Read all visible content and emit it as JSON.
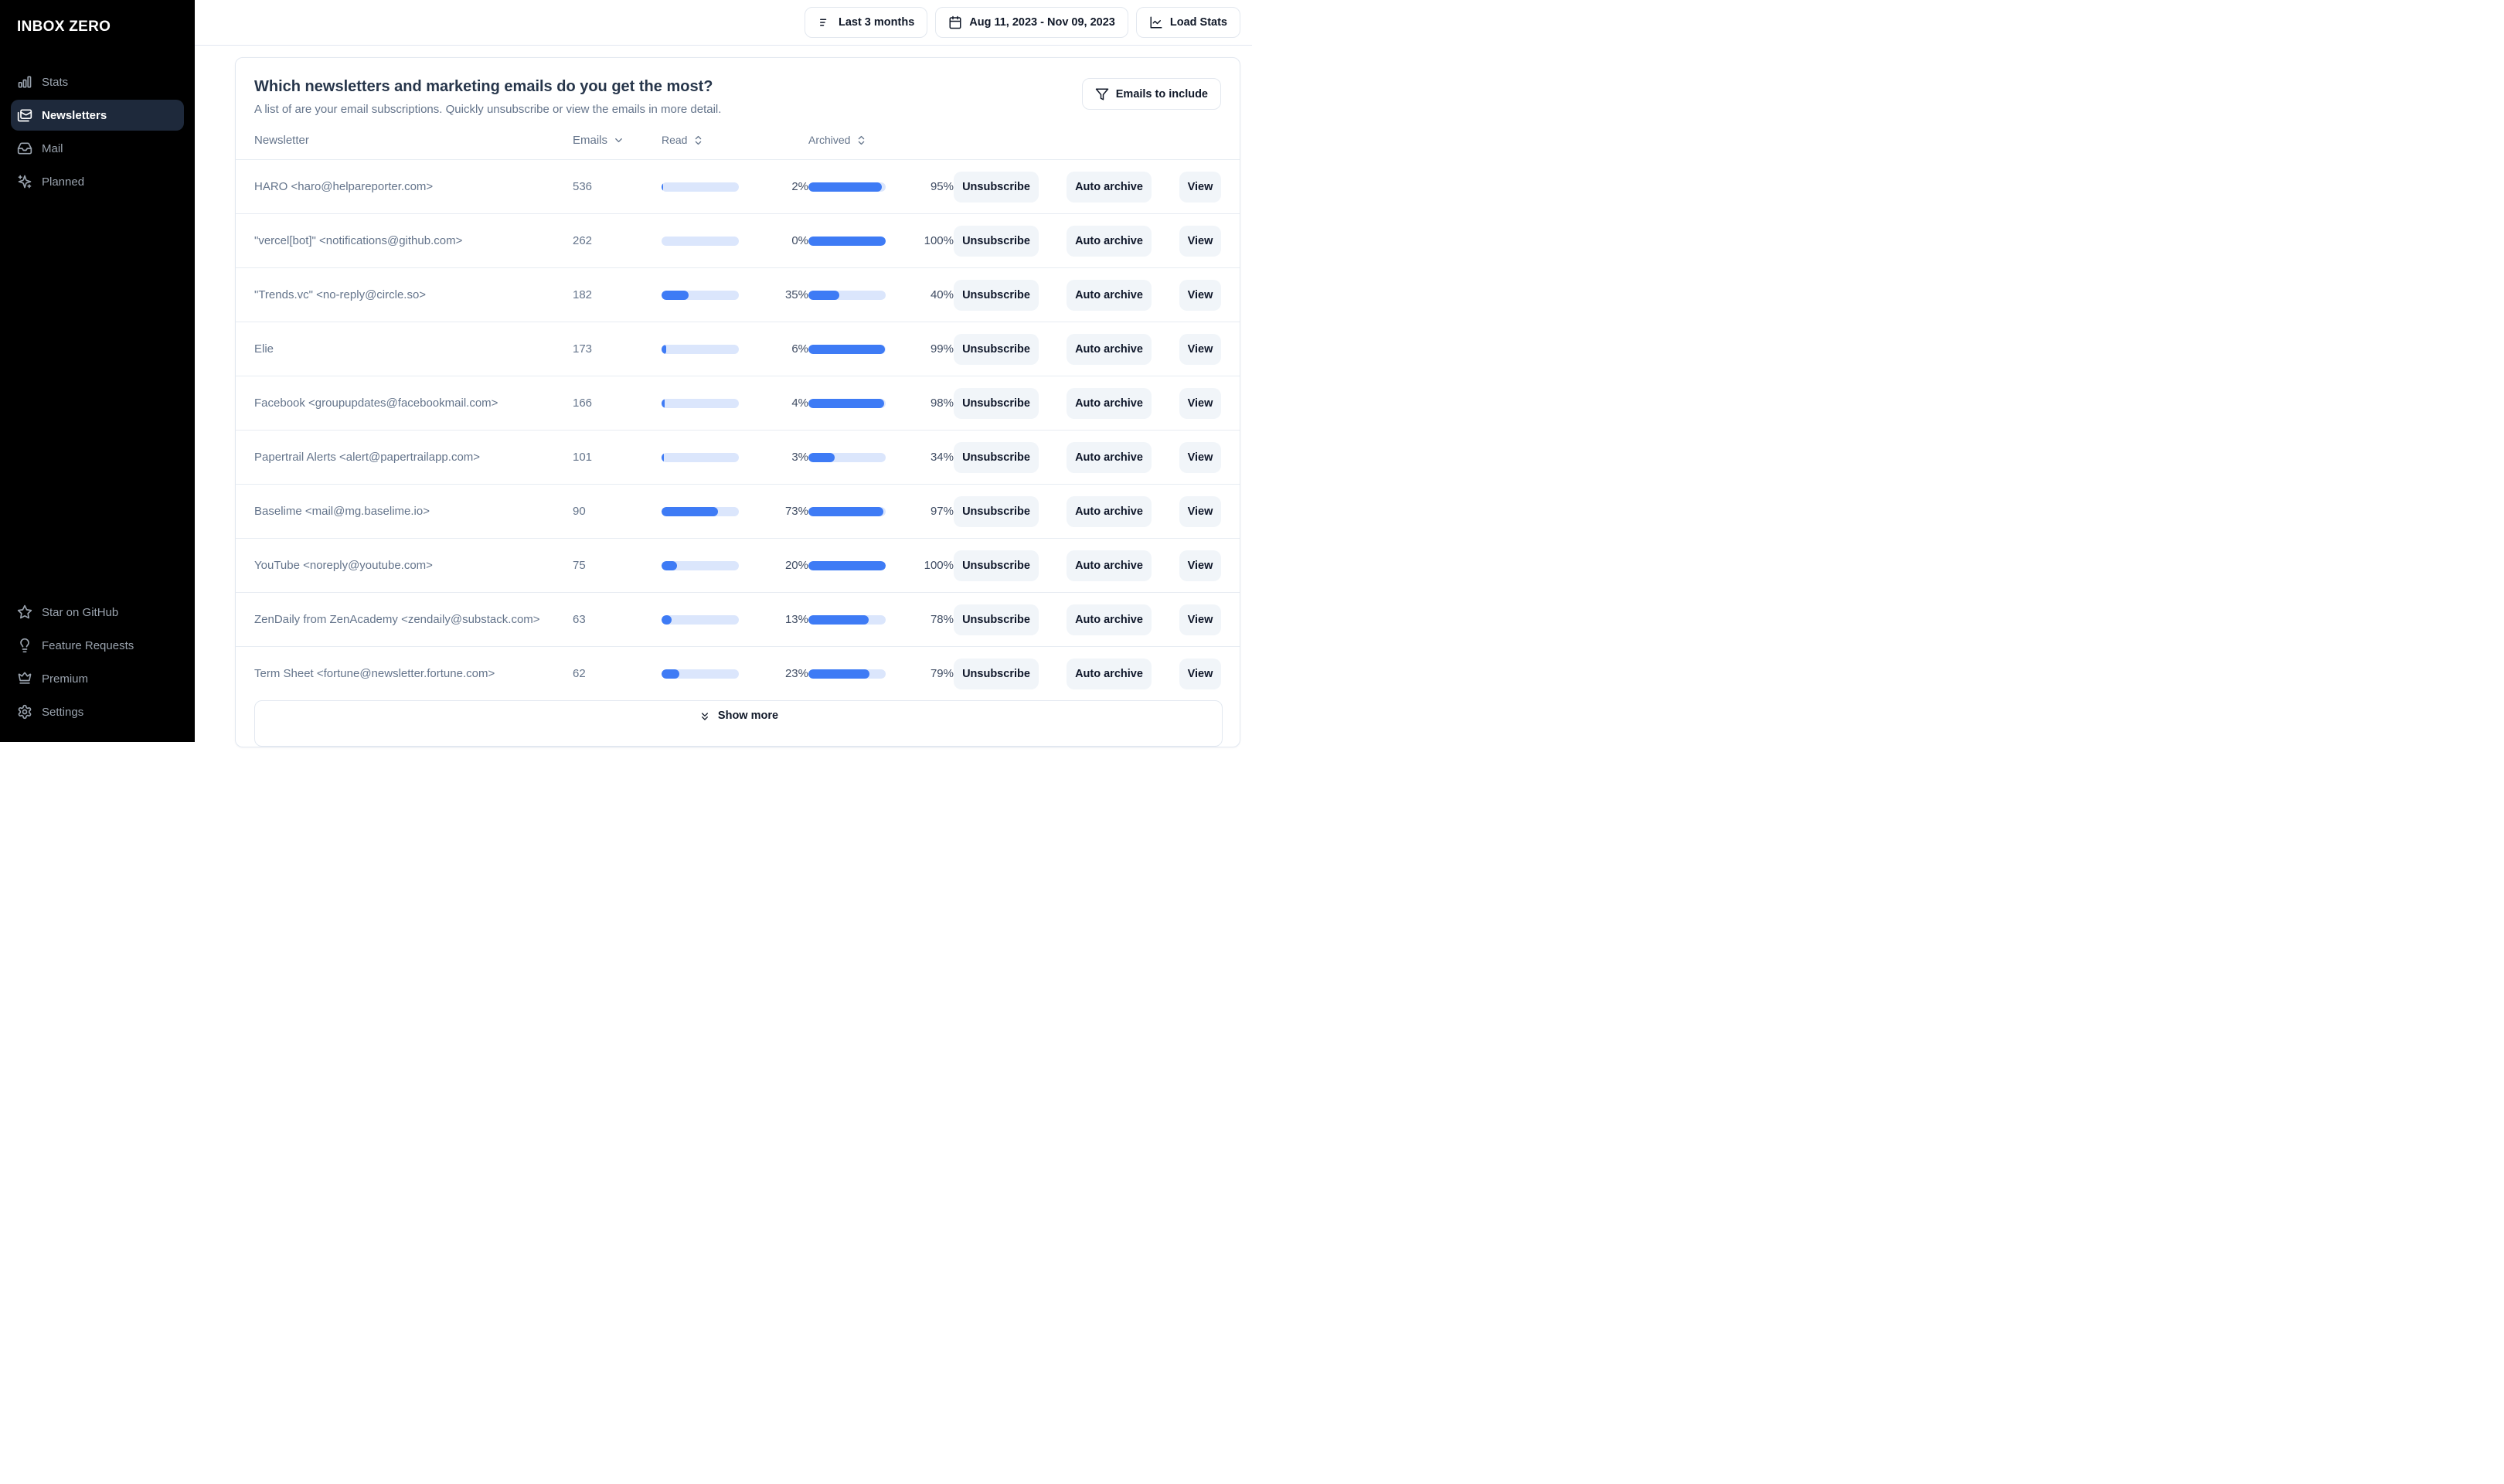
{
  "app": {
    "logo": "INBOX ZERO"
  },
  "colors": {
    "sidebar_bg": "#000000",
    "active_item_bg": "#1e293b",
    "accent_blue": "#3e7bf5",
    "bar_track": "#dbe6fc",
    "button_gray": "#f1f5f9",
    "border": "#e2e8f0"
  },
  "sidebar": {
    "items": [
      {
        "label": "Stats",
        "icon": "bar-chart-icon",
        "active": false
      },
      {
        "label": "Newsletters",
        "icon": "mails-icon",
        "active": true
      },
      {
        "label": "Mail",
        "icon": "inbox-icon",
        "active": false
      },
      {
        "label": "Planned",
        "icon": "sparkles-icon",
        "active": false
      }
    ],
    "footer_items": [
      {
        "label": "Star on GitHub",
        "icon": "star-icon",
        "active": false
      },
      {
        "label": "Feature Requests",
        "icon": "lightbulb-icon",
        "active": false
      },
      {
        "label": "Premium",
        "icon": "crown-icon",
        "active": false
      },
      {
        "label": "Settings",
        "icon": "gear-icon",
        "active": false
      }
    ]
  },
  "topbar": {
    "buttons": [
      {
        "label": "Last 3 months",
        "icon": "filter-lines-icon"
      },
      {
        "label": "Aug 11, 2023 - Nov 09, 2023",
        "icon": "calendar-icon"
      },
      {
        "label": "Load Stats",
        "icon": "line-chart-icon"
      }
    ]
  },
  "panel": {
    "title": "Which newsletters and marketing emails do you get the most?",
    "subtitle": "A list of are your email subscriptions. Quickly unsubscribe or view the emails in more detail.",
    "filter_button": {
      "label": "Emails to include",
      "icon": "funnel-icon"
    },
    "columns": {
      "newsletter": "Newsletter",
      "emails": "Emails",
      "read": "Read",
      "archived": "Archived"
    },
    "actions": {
      "unsubscribe": "Unsubscribe",
      "auto_archive": "Auto archive",
      "view": "View"
    },
    "show_more": "Show more",
    "rows": [
      {
        "name": "HARO <haro@helpareporter.com>",
        "emails": "536",
        "read_pct": 2,
        "archived_pct": 95
      },
      {
        "name": "\"vercel[bot]\" <notifications@github.com>",
        "emails": "262",
        "read_pct": 0,
        "archived_pct": 100
      },
      {
        "name": "\"Trends.vc\" <no-reply@circle.so>",
        "emails": "182",
        "read_pct": 35,
        "archived_pct": 40
      },
      {
        "name": "Elie",
        "emails": "173",
        "read_pct": 6,
        "archived_pct": 99
      },
      {
        "name": "Facebook <groupupdates@facebookmail.com>",
        "emails": "166",
        "read_pct": 4,
        "archived_pct": 98
      },
      {
        "name": "Papertrail Alerts <alert@papertrailapp.com>",
        "emails": "101",
        "read_pct": 3,
        "archived_pct": 34
      },
      {
        "name": "Baselime <mail@mg.baselime.io>",
        "emails": "90",
        "read_pct": 73,
        "archived_pct": 97
      },
      {
        "name": "YouTube <noreply@youtube.com>",
        "emails": "75",
        "read_pct": 20,
        "archived_pct": 100
      },
      {
        "name": "ZenDaily from ZenAcademy <zendaily@substack.com>",
        "emails": "63",
        "read_pct": 13,
        "archived_pct": 78
      },
      {
        "name": "Term Sheet <fortune@newsletter.fortune.com>",
        "emails": "62",
        "read_pct": 23,
        "archived_pct": 79
      }
    ]
  }
}
